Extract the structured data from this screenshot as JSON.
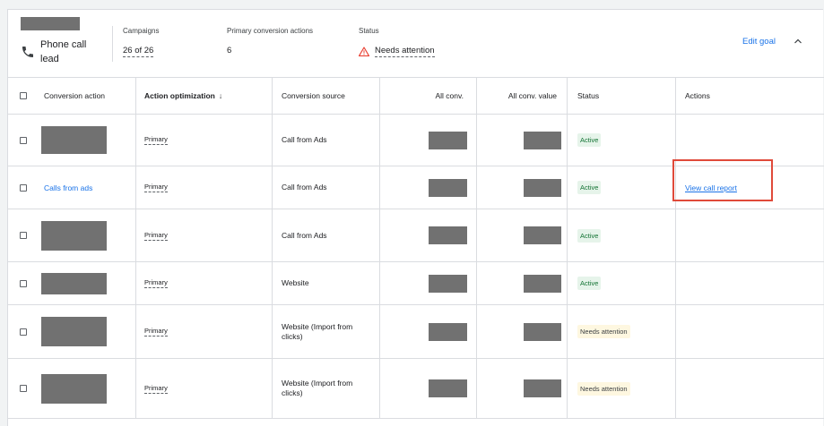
{
  "goal": {
    "title": "Phone call lead",
    "campaigns_label": "Campaigns",
    "campaigns_value": "26 of 26",
    "primary_actions_label": "Primary conversion actions",
    "primary_actions_value": "6",
    "status_label": "Status",
    "status_value": "Needs attention",
    "edit_goal": "Edit goal",
    "icons": [
      "phone-icon",
      "warning-icon",
      "chevron-up-icon"
    ],
    "warning_color": "#ea4335"
  },
  "table": {
    "headers": {
      "conversion_action": "Conversion action",
      "action_optimization": "Action optimization",
      "sort_arrow": "↓",
      "conversion_source": "Conversion source",
      "all_conv": "All conv.",
      "all_conv_value": "All conv. value",
      "status": "Status",
      "actions": "Actions"
    },
    "rows": [
      {
        "name": "",
        "optimization": "Primary",
        "source": "Call from Ads",
        "status": "Active",
        "action": ""
      },
      {
        "name": "Calls from ads",
        "optimization": "Primary",
        "source": "Call from Ads",
        "status": "Active",
        "action": "View call report"
      },
      {
        "name": "",
        "optimization": "Primary",
        "source": "Call from Ads",
        "status": "Active",
        "action": ""
      },
      {
        "name": "",
        "optimization": "Primary",
        "source": "Website",
        "status": "Active",
        "action": ""
      },
      {
        "name": "",
        "optimization": "Primary",
        "source": "Website (Import from clicks)",
        "status": "Needs attention",
        "action": ""
      },
      {
        "name": "",
        "optimization": "Primary",
        "source": "Website (Import from clicks)",
        "status": "Needs attention",
        "action": ""
      }
    ]
  },
  "colors": {
    "link": "#1a73e8",
    "active_bg": "#e6f4ea",
    "active_text": "#137333",
    "attention_bg": "#fef7e0",
    "highlight": "#e04a3a"
  }
}
